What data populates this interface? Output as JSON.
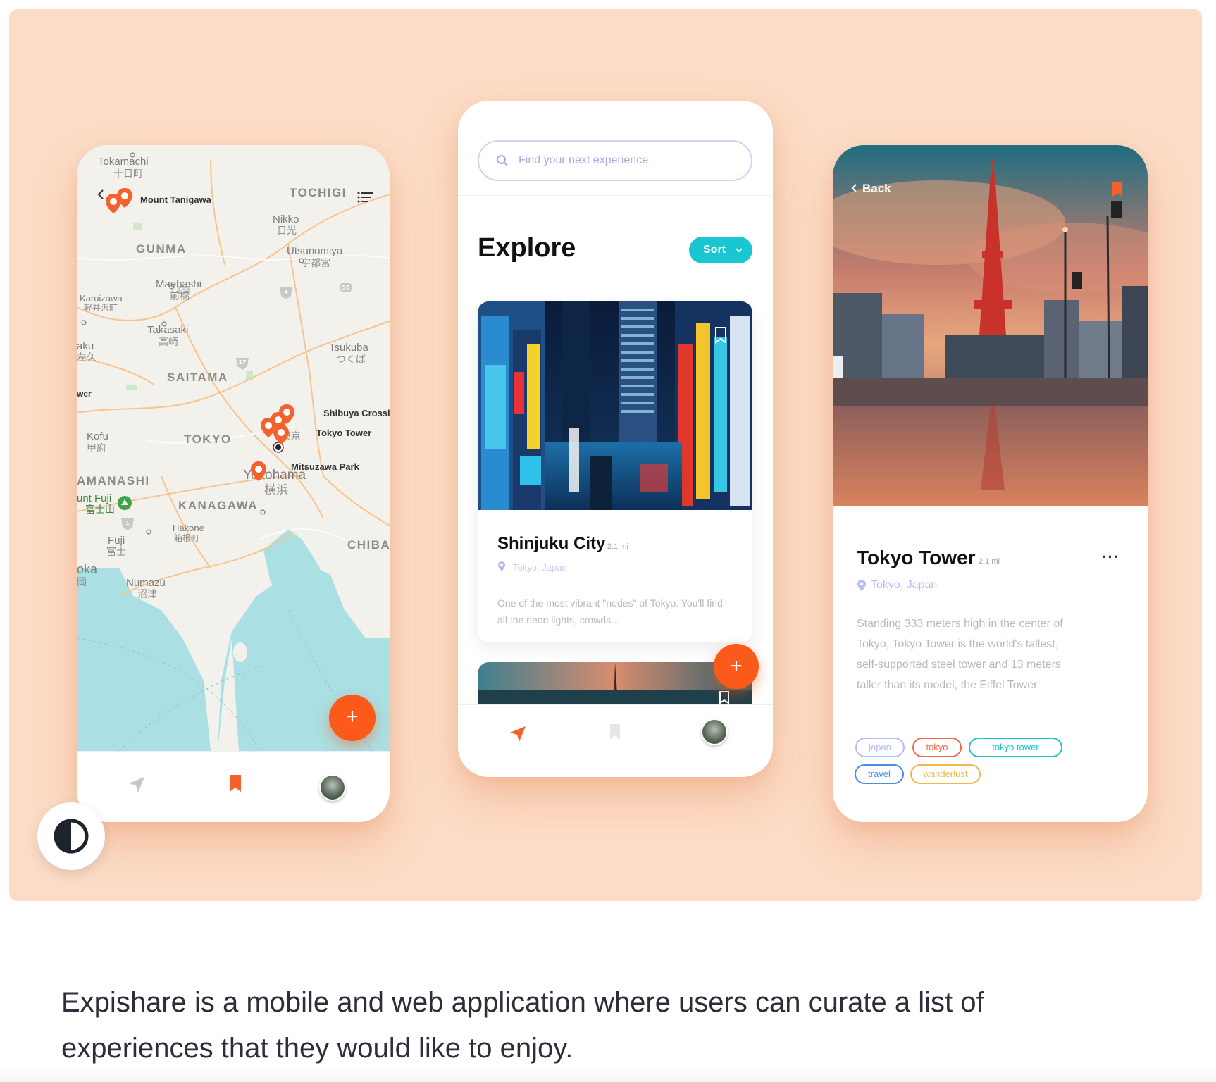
{
  "map_screen": {
    "pins": [
      "Mount Tanigawa",
      "Shibuya Crossir",
      "Tokyo Tower",
      "Mitsuzawa Park"
    ],
    "places": {
      "tokamachi": "Tokamachi",
      "tokamachi_jp": "十日町",
      "tochigi": "TOCHIGI",
      "nikko": "Nikko",
      "nikko_jp": "日光",
      "gunma": "GUNMA",
      "utsunomiya": "Utsunomiya",
      "utsunomiya_jp": "宇都宮",
      "maebashi": "Maebashi",
      "maebashi_jp": "前橋",
      "karuizawa": "Karuizawa",
      "karuizawa_jp": "軽井沢町",
      "takasaki": "Takasaki",
      "takasaki_jp": "高崎",
      "saku": "aku",
      "saku_jp": "左久",
      "tsukuba": "Tsukuba",
      "tsukuba_jp": "つくば",
      "saitama": "SAITAMA",
      "tower": "wer",
      "kofu": "Kofu",
      "kofu_jp": "甲府",
      "tokyo": "TOKYO",
      "tokyo_jp": "東京",
      "yamanashi": "AMANASHI",
      "yokohama": "Yokohama",
      "yokohama_jp": "横浜",
      "fuji_mt": "unt Fuji",
      "fuji_mt_jp": "富士山",
      "kanagawa": "KANAGAWA",
      "hakone": "Hakone",
      "hakone_jp": "箱根町",
      "chiba": "CHIBA",
      "fuji": "Fuji",
      "fuji_jp": "富士",
      "oka": "oka",
      "oka_jp": "岡",
      "numazu": "Numazu",
      "numazu_jp": "沼津"
    },
    "road_numbers": [
      "50",
      "4",
      "50",
      "17",
      "1"
    ],
    "fab_label": "+"
  },
  "explore_screen": {
    "search_placeholder": "Find your next experience",
    "title": "Explore",
    "sort_label": "Sort",
    "card": {
      "title": "Shinjuku City",
      "distance": "2.1 mi",
      "location": "Tokyo, Japan",
      "description": "One of the most vibrant \"nodes\" of Tokyo. You'll find all the neon lights, crowds..."
    },
    "fab_label": "+"
  },
  "detail_screen": {
    "back_label": "Back",
    "title": "Tokyo Tower",
    "distance": "2.1 mi",
    "more_label": "···",
    "location": "Tokyo, Japan",
    "description": "Standing 333 meters high in the center of Tokyo, Tokyo Tower is the world's tallest, self-supported steel tower and 13 meters taller than its model, the Eiffel Tower.",
    "tags": [
      "japan",
      "tokyo",
      "tokyo tower",
      "travel",
      "wanderlust"
    ]
  },
  "colors": {
    "background": "#fcdcc6",
    "accent": "#fb5a1a",
    "teal": "#1bc6d3",
    "periwinkle": "#b6bdf0",
    "tag_japan": "#b6bdf0",
    "tag_tokyo": "#f26a4b",
    "tag_tokyo_tower": "#1bc6d3",
    "tag_travel": "#4a8fe0",
    "tag_wanderlust": "#f2b84b"
  },
  "caption": "Expishare is a mobile and web application where users can curate a list of experiences that they would like to enjoy."
}
